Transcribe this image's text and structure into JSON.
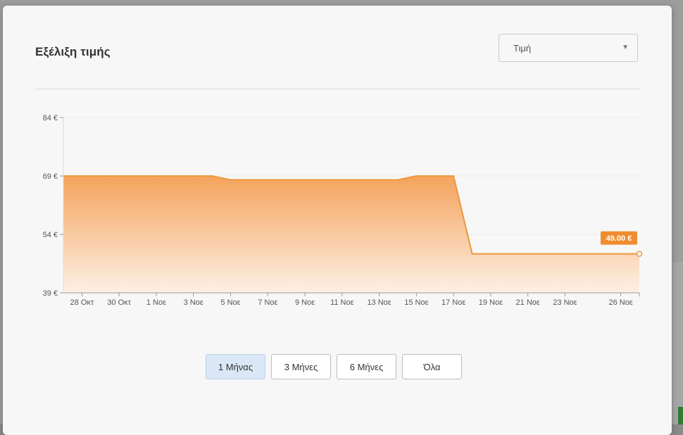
{
  "modal": {
    "title": "Εξέλιξη τιμής",
    "select": {
      "value": "Τιμή"
    },
    "range_buttons": [
      {
        "label": "1 Μήνας",
        "active": true
      },
      {
        "label": "3 Μήνες",
        "active": false
      },
      {
        "label": "6 Μήνες",
        "active": false
      },
      {
        "label": "Όλα",
        "active": false
      }
    ]
  },
  "colors": {
    "line": "#f0963c",
    "fill_top": "#f4a35c",
    "fill_bottom": "#fdf0e5",
    "label_bg": "#ef8d2f"
  },
  "chart_data": {
    "type": "area",
    "title": "",
    "xlabel": "",
    "ylabel": "",
    "currency": "€",
    "ylim": [
      39,
      84
    ],
    "yticks": [
      39,
      54,
      69,
      84
    ],
    "ytick_labels": [
      "39 €",
      "54 €",
      "69 €",
      "84 €"
    ],
    "xlim": [
      "2023-10-27",
      "2023-11-27"
    ],
    "xticks": [
      {
        "date": "2023-10-28",
        "label": "28 Οκτ"
      },
      {
        "date": "2023-10-30",
        "label": "30 Οκτ"
      },
      {
        "date": "2023-11-01",
        "label": "1 Νοε"
      },
      {
        "date": "2023-11-03",
        "label": "3 Νοε"
      },
      {
        "date": "2023-11-05",
        "label": "5 Νοε"
      },
      {
        "date": "2023-11-07",
        "label": "7 Νοε"
      },
      {
        "date": "2023-11-09",
        "label": "9 Νοε"
      },
      {
        "date": "2023-11-11",
        "label": "11 Νοε"
      },
      {
        "date": "2023-11-13",
        "label": "13 Νοε"
      },
      {
        "date": "2023-11-15",
        "label": "15 Νοε"
      },
      {
        "date": "2023-11-17",
        "label": "17 Νοε"
      },
      {
        "date": "2023-11-19",
        "label": "19 Νοε"
      },
      {
        "date": "2023-11-21",
        "label": "21 Νοε"
      },
      {
        "date": "2023-11-23",
        "label": "23 Νοε"
      },
      {
        "date": "2023-11-26",
        "label": "26 Νοε"
      }
    ],
    "series": [
      {
        "points": [
          {
            "x": "2023-10-27",
            "y": 69
          },
          {
            "x": "2023-11-04",
            "y": 69
          },
          {
            "x": "2023-11-05",
            "y": 68
          },
          {
            "x": "2023-11-14",
            "y": 68
          },
          {
            "x": "2023-11-15",
            "y": 69
          },
          {
            "x": "2023-11-17",
            "y": 69
          },
          {
            "x": "2023-11-18",
            "y": 49
          },
          {
            "x": "2023-11-27",
            "y": 49
          }
        ]
      }
    ],
    "last_value_label": "49.00 €",
    "grid": true
  }
}
